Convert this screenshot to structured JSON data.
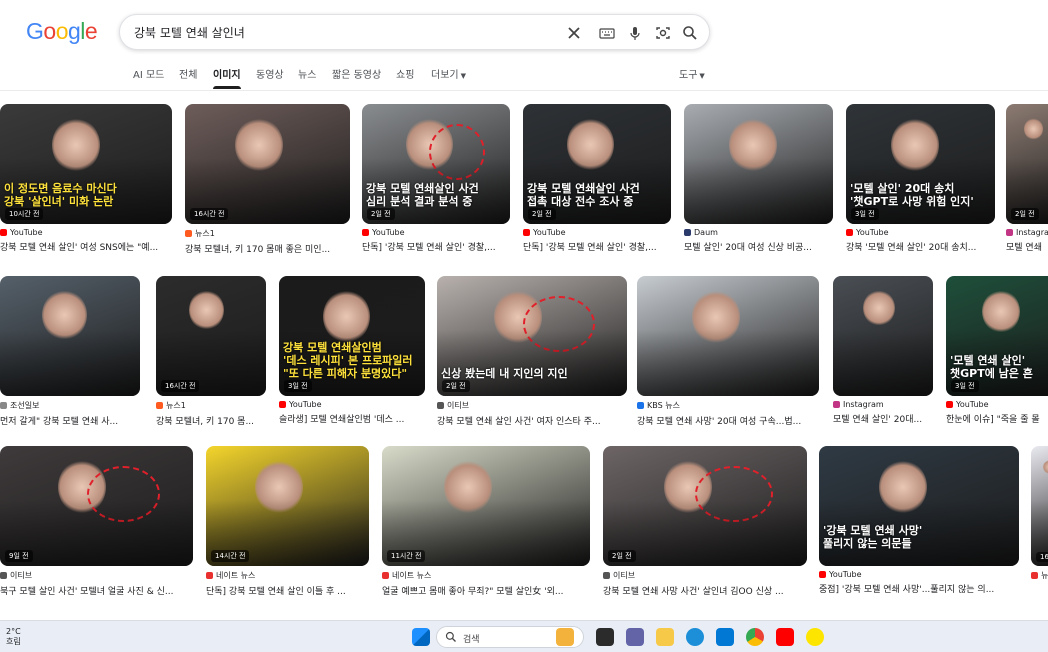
{
  "search": {
    "query": "강북 모텔 연쇄 살인녀",
    "logo": [
      "G",
      "o",
      "o",
      "g",
      "l",
      "e"
    ],
    "logo_colors": [
      "#4285f4",
      "#ea4335",
      "#fbbc05",
      "#4285f4",
      "#34a853",
      "#ea4335"
    ]
  },
  "tabs": [
    "AI 모드",
    "전체",
    "이미지",
    "동영상",
    "뉴스",
    "짧은 동영상",
    "쇼핑",
    "더보기",
    "도구"
  ],
  "results": [
    {
      "caption": "이 정도면 음료수 마신다\n강북 '살인녀' 미화 논란",
      "badge": "10시간 전",
      "source": "YouTube",
      "title": "강북 모텔 연쇄 살인' 여성 SNS에는 \"예...",
      "ico": "#ff0000"
    },
    {
      "caption": "",
      "badge": "16시간 전",
      "source": "뉴스1",
      "title": "강북 모텔녀, 키 170 몸매 좋은 미인...",
      "ico": "#ff5a1f"
    },
    {
      "caption": "강북 모텔 연쇄살인 사건\n심리 분석 결과 분석 중",
      "badge": "2일 전",
      "source": "YouTube",
      "title": "단독] '강북 모텔 연쇄 살인' 경찰,...",
      "ico": "#ff0000"
    },
    {
      "caption": "강북 모텔 연쇄살인 사건\n접촉 대상 전수 조사 중",
      "badge": "2일 전",
      "source": "YouTube",
      "title": "단독] '강북 모텔 연쇄 살인' 경찰,...",
      "ico": "#ff0000"
    },
    {
      "caption": "",
      "badge": "",
      "source": "Daum",
      "title": "모텔 살인' 20대 여성 신상 비공...",
      "ico": "#2a3a6b"
    },
    {
      "caption": "'모텔 살인' 20대 송치\n'챗GPT로 사망 위험 인지'",
      "badge": "3일 전",
      "source": "YouTube",
      "title": "강북 '모텔 연쇄 살인' 20대 송치...",
      "ico": "#ff0000"
    },
    {
      "caption": "",
      "badge": "2일 전",
      "source": "Instagram",
      "title": "모텔 연쇄",
      "ico": "#c13584"
    },
    {
      "caption": "",
      "badge": "",
      "source": "조선일보",
      "title": "먼저 갈게\" 강북 모텔 연쇄 사...",
      "ico": "#888888"
    },
    {
      "caption": "",
      "badge": "16시간 전",
      "source": "뉴스1",
      "title": "강북 모텔녀, 키 170 몸...",
      "ico": "#ff5a1f"
    },
    {
      "caption": "강북 모텔 연쇄살인범\n'데스 레시피' 본 프로파일러\n\"또 다른 피해자 분명있다\"",
      "badge": "3일 전",
      "source": "YouTube",
      "title": "슬라생] 모텔 연쇄살인범 '데스 ...",
      "ico": "#ff0000"
    },
    {
      "caption": "신상 봤는데 내 지인의 지인",
      "badge": "2일 전",
      "source": "이티브",
      "title": "강북 모텔 연쇄 살인 사건' 여자 인스타 주...",
      "ico": "#555555"
    },
    {
      "caption": "",
      "badge": "",
      "source": "KBS 뉴스",
      "title": "강북 모텔 연쇄 사망' 20대 여성 구속...법...",
      "ico": "#1a73e8"
    },
    {
      "caption": "",
      "badge": "",
      "source": "Instagram",
      "title": "모텔 연쇄 살인' 20대...",
      "ico": "#c13584"
    },
    {
      "caption": "'모텔 연쇄 살인'\n챗GPT에 남은 흔",
      "badge": "3일 전",
      "source": "YouTube",
      "title": "한눈에 이슈] \"죽을 줄 몰",
      "ico": "#ff0000"
    },
    {
      "caption": "",
      "badge": "9일 전",
      "source": "이티브",
      "title": "북구 모텔 살인 사건' 모텔녀 얼굴 사진 & 신...",
      "ico": "#555555"
    },
    {
      "caption": "",
      "badge": "14시간 전",
      "source": "네이트 뉴스",
      "title": "단독] 강북 모텔 연쇄 살인 이틀 후 ...",
      "ico": "#e8312f"
    },
    {
      "caption": "",
      "badge": "11시간 전",
      "source": "네이트 뉴스",
      "title": "얼굴 예쁘고 몸매 좋아 무죄?\" 모텔 살인女 '외...",
      "ico": "#e8312f"
    },
    {
      "caption": "",
      "badge": "2일 전",
      "source": "이티브",
      "title": "강북 모텔 연쇄 사망 사건' 살인녀 김OO 신상 ...",
      "ico": "#555555"
    },
    {
      "caption": "'강북 모텔 연쇄 사망'\n풀리지 않는 의문들",
      "badge": "",
      "source": "YouTube",
      "title": "중점] '강북 모텔 연쇄 사망'...풀리지 않는 의...",
      "ico": "#ff0000"
    },
    {
      "caption": "",
      "badge": "16",
      "source": "뉴",
      "title": "",
      "ico": "#e8312f"
    }
  ],
  "taskbar": {
    "temp": "2°C",
    "weather": "흐림",
    "search_placeholder": "검색"
  },
  "colors": {
    "accent": "#1a73e8",
    "red_ring": "#e0202a",
    "taskbar": "#e9eef6"
  }
}
